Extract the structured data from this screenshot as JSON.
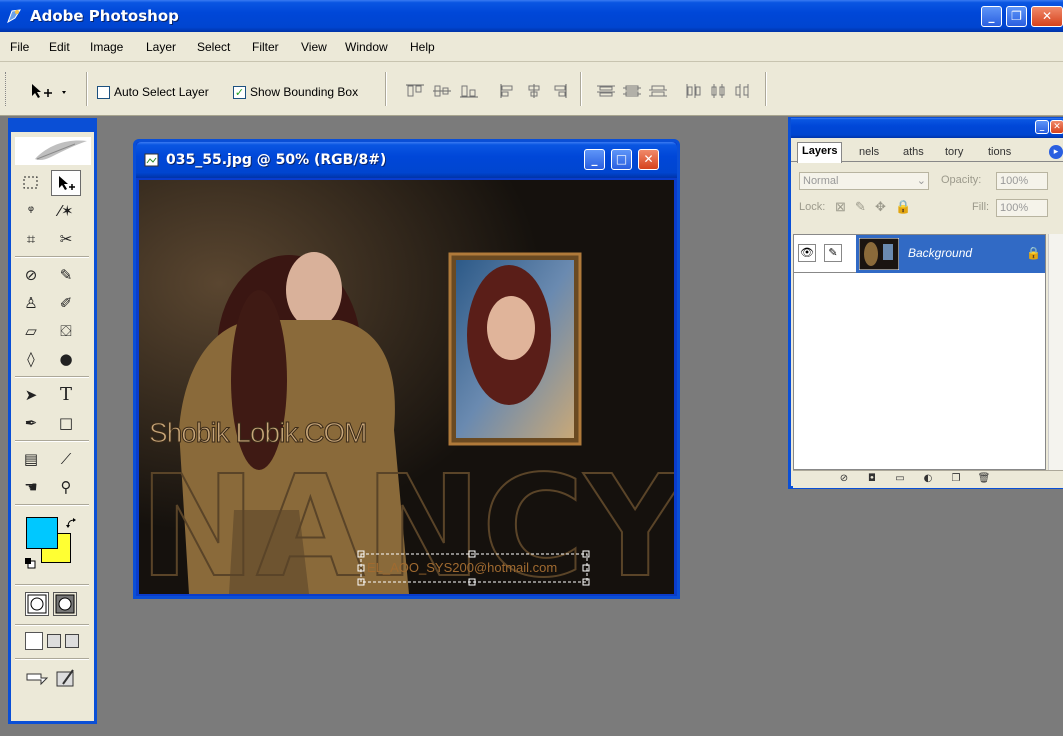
{
  "app": {
    "title": "Adobe Photoshop",
    "window_buttons": [
      "_",
      "❐",
      "✕"
    ]
  },
  "menu": [
    "File",
    "Edit",
    "Image",
    "Layer",
    "Select",
    "Filter",
    "View",
    "Window",
    "Help"
  ],
  "options": {
    "auto_select_layer": {
      "label": "Auto Select Layer",
      "checked": false
    },
    "show_bounding_box": {
      "label": "Show Bounding Box",
      "checked": true
    }
  },
  "colors": {
    "foreground": "#00c8ff",
    "background": "#ffff33"
  },
  "document": {
    "title": "035_55.jpg @ 50% (RGB/8#)",
    "watermark": "Shobik Lobik.COM",
    "big_text": "NANCY",
    "email_text": "EL_AOO_SYS200@hotmail.com"
  },
  "layers_panel": {
    "tabs": [
      "Layers",
      "nels",
      "aths",
      "tory",
      "tions"
    ],
    "blend_mode": "Normal",
    "opacity_label": "Opacity:",
    "opacity_value": "100%",
    "lock_label": "Lock:",
    "fill_label": "Fill:",
    "fill_value": "100%",
    "layer_name": "Background"
  }
}
